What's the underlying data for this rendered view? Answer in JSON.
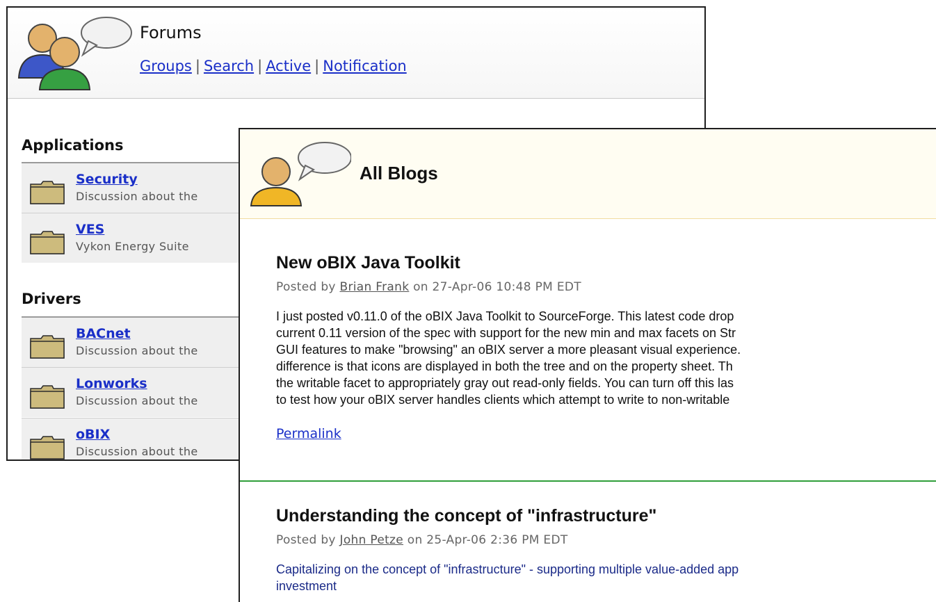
{
  "forums": {
    "title": "Forums",
    "nav": [
      "Groups",
      "Search",
      "Active",
      "Notification"
    ],
    "sections": [
      {
        "heading": "Applications",
        "items": [
          {
            "name": "Security",
            "description": "Discussion about the"
          },
          {
            "name": "VES",
            "description": "Vykon Energy Suite"
          }
        ]
      },
      {
        "heading": "Drivers",
        "items": [
          {
            "name": "BACnet",
            "description": "Discussion about the"
          },
          {
            "name": "Lonworks",
            "description": "Discussion about the"
          },
          {
            "name": "oBIX",
            "description": "Discussion about the"
          }
        ]
      }
    ]
  },
  "blogs": {
    "title": "All Blogs",
    "posts": [
      {
        "title": "New oBIX Java Toolkit",
        "meta_prefix": "Posted by",
        "author": "Brian Frank",
        "meta_suffix": "on 27-Apr-06 10:48 PM EDT",
        "body": [
          "I just posted v0.11.0 of the oBIX Java Toolkit to SourceForge.  This latest code drop",
          "current 0.11 version of the spec with support for the new min and max facets on Str",
          "GUI features to make \"browsing\" an oBIX server a more pleasant visual experience.",
          "difference is that icons are displayed in both the tree and on the property sheet.  Th",
          "the writable facet to appropriately gray out read-only fields.  You can turn off this las",
          "to test how your oBIX server handles clients which attempt to write to non-writable"
        ],
        "permalink": "Permalink"
      },
      {
        "title": "Understanding the concept of \"infrastructure\"",
        "meta_prefix": "Posted by",
        "author": "John Petze",
        "meta_suffix": "on 25-Apr-06 2:36 PM EDT",
        "body": [
          "Capitalizing on the concept of \"infrastructure\" - supporting multiple value-added app",
          "investment"
        ]
      }
    ]
  }
}
